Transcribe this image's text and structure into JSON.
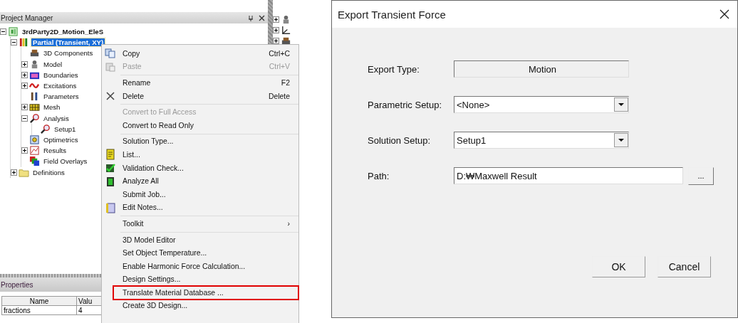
{
  "project_manager": {
    "title": "Project Manager",
    "tree": [
      {
        "label": "3rdParty2D_Motion_EleS",
        "kind": "project",
        "expanded": true,
        "selected": false,
        "children": [
          {
            "label": "Partial (Transient, XY)",
            "kind": "design",
            "expanded": true,
            "selected": true,
            "children": [
              {
                "label": "3D Components",
                "kind": "components",
                "selected": false
              },
              {
                "label": "Model",
                "kind": "model",
                "expanded": false,
                "selected": false
              },
              {
                "label": "Boundaries",
                "kind": "boundaries",
                "expanded": false,
                "selected": false
              },
              {
                "label": "Excitations",
                "kind": "excitations",
                "expanded": false,
                "selected": false
              },
              {
                "label": "Parameters",
                "kind": "parameters",
                "selected": false
              },
              {
                "label": "Mesh",
                "kind": "mesh",
                "expanded": false,
                "selected": false
              },
              {
                "label": "Analysis",
                "kind": "analysis",
                "expanded": true,
                "selected": false,
                "children": [
                  {
                    "label": "Setup1",
                    "kind": "analysis",
                    "selected": false
                  }
                ]
              },
              {
                "label": "Optimetrics",
                "kind": "optimetrics",
                "selected": false
              },
              {
                "label": "Results",
                "kind": "results",
                "expanded": false,
                "selected": false
              },
              {
                "label": "Field Overlays",
                "kind": "overlays",
                "selected": false
              }
            ]
          },
          {
            "label": "Definitions",
            "kind": "folder",
            "expanded": false,
            "selected": false
          }
        ]
      }
    ]
  },
  "side_tree": [
    {
      "kind": "model",
      "expanded": false
    },
    {
      "kind": "axes",
      "expanded": false
    },
    {
      "kind": "components",
      "expanded": false
    }
  ],
  "context_menu": {
    "sections": [
      [
        {
          "label": "Copy",
          "shortcut": "Ctrl+C",
          "kind": "copy",
          "disabled": false,
          "highlighted": false
        },
        {
          "label": "Paste",
          "shortcut": "Ctrl+V",
          "kind": "paste",
          "disabled": true,
          "highlighted": false
        }
      ],
      [
        {
          "label": "Rename",
          "shortcut": "F2",
          "kind": "plain",
          "disabled": false,
          "highlighted": false
        },
        {
          "label": "Delete",
          "shortcut": "Delete",
          "kind": "delete",
          "disabled": false,
          "highlighted": false
        }
      ],
      [
        {
          "label": "Convert to Full Access",
          "kind": "plain",
          "disabled": true,
          "highlighted": false
        },
        {
          "label": "Convert to Read Only",
          "kind": "plain",
          "disabled": false,
          "highlighted": false
        }
      ],
      [
        {
          "label": "Solution Type...",
          "kind": "plain",
          "disabled": false,
          "highlighted": false
        },
        {
          "label": "List...",
          "kind": "list",
          "disabled": false,
          "highlighted": false
        },
        {
          "label": "Validation Check...",
          "kind": "validate",
          "disabled": false,
          "highlighted": false
        },
        {
          "label": "Analyze All",
          "kind": "analyze",
          "disabled": false,
          "highlighted": false
        },
        {
          "label": "Submit Job...",
          "kind": "plain",
          "disabled": false,
          "highlighted": false
        },
        {
          "label": "Edit Notes...",
          "kind": "notes",
          "disabled": false,
          "highlighted": false
        }
      ],
      [
        {
          "label": "Toolkit",
          "submenu": "›",
          "kind": "plain",
          "disabled": false,
          "highlighted": false
        }
      ],
      [
        {
          "label": "3D Model Editor",
          "kind": "plain",
          "disabled": false,
          "highlighted": false
        },
        {
          "label": "Set Object Temperature...",
          "kind": "plain",
          "disabled": false,
          "highlighted": false
        },
        {
          "label": "Enable Harmonic Force Calculation...",
          "kind": "plain",
          "disabled": false,
          "highlighted": false
        },
        {
          "label": "Design Settings...",
          "kind": "plain",
          "disabled": false,
          "highlighted": false
        },
        {
          "label": "Translate Material Database ...",
          "kind": "plain",
          "disabled": false,
          "highlighted": true
        },
        {
          "label": "Create 3D Design...",
          "kind": "plain",
          "disabled": false,
          "highlighted": false
        }
      ]
    ]
  },
  "properties": {
    "title": "Properties",
    "columns": [
      "Name",
      "Valu"
    ],
    "rows": [
      [
        "fractions",
        "4"
      ]
    ]
  },
  "dialog": {
    "title": "Export Transient Force",
    "fields": [
      {
        "label": "Export Type:",
        "kind": "readonly",
        "value": "Motion"
      },
      {
        "label": "Parametric Setup:",
        "kind": "dropdown",
        "value": "<None>"
      },
      {
        "label": "Solution Setup:",
        "kind": "dropdown",
        "value": "Setup1"
      },
      {
        "label": "Path:",
        "kind": "path",
        "value": "D:₩Maxwell Result",
        "button": "..."
      }
    ],
    "buttons": [
      "OK",
      "Cancel"
    ]
  }
}
